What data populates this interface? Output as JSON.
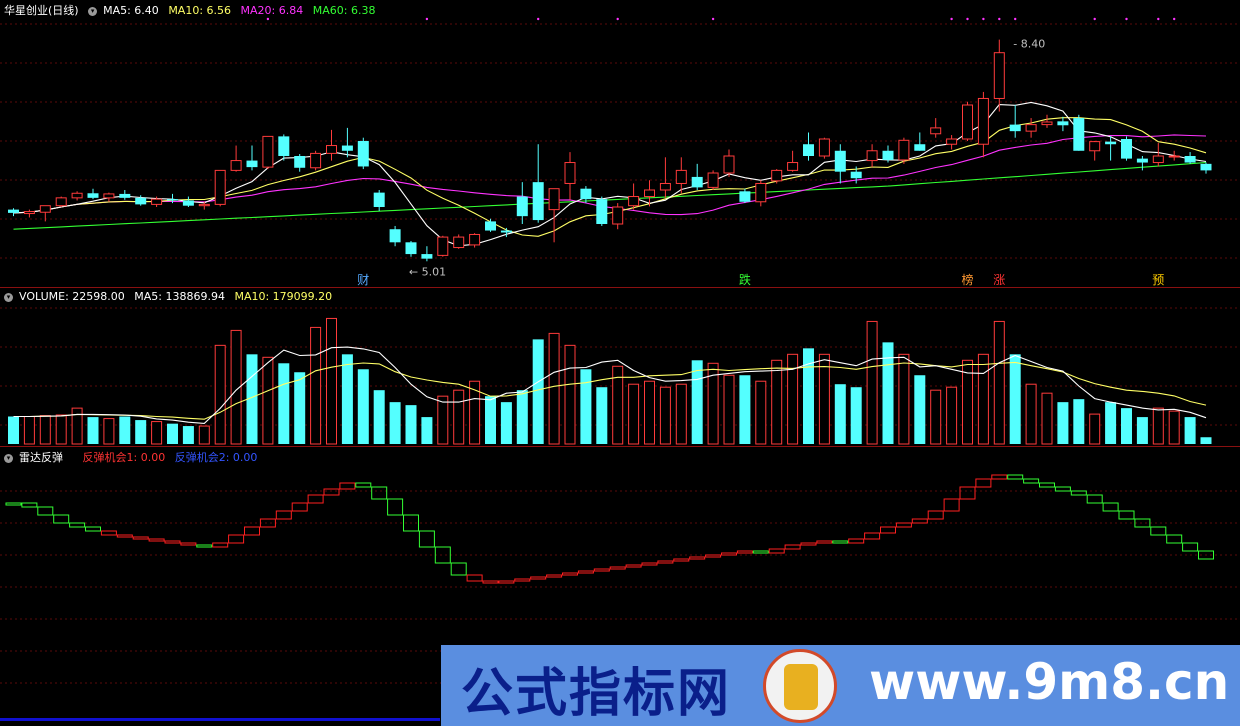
{
  "colors": {
    "up": "#ff3b3b",
    "down": "#54ffff",
    "ma5": "#ffffff",
    "ma10": "#ffff66",
    "ma20": "#ff33ff",
    "ma60": "#33ff33",
    "radar_up": "#ff2020",
    "radar_down": "#33ff33",
    "blue": "#3333ff"
  },
  "price_panel": {
    "stock_name": "华星创业(日线)",
    "ma5_label": "MA5: 6.40",
    "ma10_label": "MA10: 6.56",
    "ma20_label": "MA20: 6.84",
    "ma60_label": "MA60: 6.38",
    "high_marker": "8.40",
    "low_marker": "5.01",
    "event_labels": [
      {
        "text": "财",
        "index": 22,
        "color": "#55aaff"
      },
      {
        "text": "跌",
        "index": 46,
        "color": "#33ff33"
      },
      {
        "text": "榜",
        "index": 60,
        "color": "#ff9933"
      },
      {
        "text": "涨",
        "index": 62,
        "color": "#ff3333"
      },
      {
        "text": "预",
        "index": 72,
        "color": "#ffcc00"
      }
    ]
  },
  "volume_panel": {
    "volume_label": "VOLUME: 22598.00",
    "ma5_label": "MA5: 138869.94",
    "ma10_label": "MA10: 179099.20"
  },
  "radar_panel": {
    "name": "雷达反弹",
    "signal1_label": "反弹机会1: 0.00",
    "signal2_label": "反弹机会2: 0.00"
  },
  "watermark": {
    "text1": "公式指标网",
    "text2": "www.9m8.cn"
  },
  "chart_data": [
    {
      "type": "candlestick",
      "name": "华星创业(日线)",
      "ylim": [
        4.8,
        8.7
      ],
      "ohlc": [
        [
          5.8,
          5.82,
          5.7,
          5.75
        ],
        [
          5.74,
          5.8,
          5.68,
          5.77
        ],
        [
          5.76,
          5.85,
          5.62,
          5.86
        ],
        [
          5.86,
          6.0,
          5.84,
          5.98
        ],
        [
          5.98,
          6.08,
          5.94,
          6.05
        ],
        [
          6.05,
          6.12,
          5.96,
          5.98
        ],
        [
          5.98,
          6.06,
          5.92,
          6.04
        ],
        [
          6.04,
          6.1,
          5.95,
          5.98
        ],
        [
          5.98,
          6.02,
          5.86,
          5.88
        ],
        [
          5.88,
          6.0,
          5.84,
          5.96
        ],
        [
          5.96,
          6.04,
          5.9,
          5.94
        ],
        [
          5.94,
          6.0,
          5.84,
          5.86
        ],
        [
          5.86,
          5.92,
          5.8,
          5.88
        ],
        [
          5.88,
          6.4,
          5.85,
          6.4
        ],
        [
          6.4,
          6.78,
          6.38,
          6.55
        ],
        [
          6.55,
          6.78,
          6.4,
          6.45
        ],
        [
          6.45,
          6.92,
          6.42,
          6.92
        ],
        [
          6.92,
          6.95,
          6.55,
          6.62
        ],
        [
          6.62,
          6.65,
          6.38,
          6.44
        ],
        [
          6.44,
          6.7,
          6.4,
          6.66
        ],
        [
          6.66,
          7.02,
          6.55,
          6.78
        ],
        [
          6.78,
          7.05,
          6.6,
          6.7
        ],
        [
          6.85,
          6.9,
          6.42,
          6.46
        ],
        [
          6.06,
          6.1,
          5.78,
          5.84
        ],
        [
          5.5,
          5.55,
          5.24,
          5.3
        ],
        [
          5.3,
          5.32,
          5.08,
          5.12
        ],
        [
          5.12,
          5.24,
          5.01,
          5.05
        ],
        [
          5.1,
          5.4,
          5.08,
          5.38
        ],
        [
          5.22,
          5.42,
          5.2,
          5.38
        ],
        [
          5.26,
          5.44,
          5.22,
          5.42
        ],
        [
          5.62,
          5.66,
          5.46,
          5.48
        ],
        [
          5.48,
          5.52,
          5.38,
          5.45
        ],
        [
          6.0,
          6.22,
          5.58,
          5.7
        ],
        [
          6.22,
          6.8,
          5.6,
          5.64
        ],
        [
          5.8,
          6.1,
          5.3,
          6.12
        ],
        [
          6.2,
          6.68,
          5.95,
          6.52
        ],
        [
          6.12,
          6.16,
          5.9,
          5.96
        ],
        [
          5.96,
          6.0,
          5.55,
          5.58
        ],
        [
          5.58,
          5.9,
          5.5,
          5.84
        ],
        [
          5.86,
          6.2,
          5.8,
          6.0
        ],
        [
          6.0,
          6.25,
          5.85,
          6.1
        ],
        [
          6.1,
          6.6,
          5.98,
          6.2
        ],
        [
          6.2,
          6.6,
          6.05,
          6.4
        ],
        [
          6.3,
          6.5,
          6.1,
          6.14
        ],
        [
          6.14,
          6.4,
          6.1,
          6.36
        ],
        [
          6.36,
          6.72,
          6.3,
          6.62
        ],
        [
          6.08,
          6.12,
          5.9,
          5.92
        ],
        [
          5.92,
          6.25,
          5.85,
          6.2
        ],
        [
          6.24,
          6.42,
          6.2,
          6.4
        ],
        [
          6.4,
          6.7,
          6.38,
          6.52
        ],
        [
          6.8,
          6.98,
          6.55,
          6.62
        ],
        [
          6.62,
          6.9,
          6.58,
          6.88
        ],
        [
          6.7,
          6.8,
          6.2,
          6.38
        ],
        [
          6.38,
          6.46,
          6.2,
          6.28
        ],
        [
          6.55,
          6.8,
          6.45,
          6.7
        ],
        [
          6.7,
          6.78,
          6.52,
          6.56
        ],
        [
          6.56,
          6.9,
          6.5,
          6.86
        ],
        [
          6.8,
          6.98,
          6.7,
          6.7
        ],
        [
          6.96,
          7.2,
          6.9,
          7.05
        ],
        [
          6.8,
          6.94,
          6.72,
          6.88
        ],
        [
          6.88,
          7.45,
          6.85,
          7.4
        ],
        [
          6.8,
          7.6,
          6.6,
          7.5
        ],
        [
          7.5,
          8.4,
          7.3,
          8.2
        ],
        [
          7.1,
          7.4,
          6.9,
          7.0
        ],
        [
          7.0,
          7.2,
          6.9,
          7.1
        ],
        [
          7.1,
          7.25,
          7.05,
          7.14
        ],
        [
          7.15,
          7.22,
          7.0,
          7.09
        ],
        [
          7.2,
          7.25,
          6.7,
          6.7
        ],
        [
          6.7,
          6.85,
          6.55,
          6.84
        ],
        [
          6.84,
          6.92,
          6.55,
          6.8
        ],
        [
          6.88,
          6.92,
          6.55,
          6.58
        ],
        [
          6.58,
          6.62,
          6.4,
          6.52
        ],
        [
          6.52,
          6.82,
          6.46,
          6.62
        ],
        [
          6.62,
          6.7,
          6.55,
          6.62
        ],
        [
          6.62,
          6.68,
          6.5,
          6.52
        ],
        [
          6.5,
          6.52,
          6.35,
          6.4
        ]
      ]
    },
    {
      "type": "bar",
      "name": "VOLUME",
      "ylim": [
        0,
        475000
      ],
      "values": [
        92000,
        92000,
        95000,
        97000,
        120000,
        90000,
        85000,
        92000,
        80000,
        75000,
        68000,
        60000,
        60000,
        330000,
        380000,
        300000,
        290000,
        270000,
        240000,
        390000,
        420000,
        300000,
        250000,
        180000,
        140000,
        130000,
        90000,
        160000,
        180000,
        210000,
        160000,
        140000,
        180000,
        350000,
        370000,
        330000,
        250000,
        190000,
        260000,
        200000,
        210000,
        190000,
        200000,
        280000,
        270000,
        230000,
        230000,
        210000,
        280000,
        300000,
        320000,
        300000,
        200000,
        190000,
        410000,
        340000,
        300000,
        230000,
        180000,
        190000,
        280000,
        300000,
        410000,
        300000,
        200000,
        170000,
        140000,
        150000,
        100000,
        140000,
        120000,
        90000,
        120000,
        110000,
        90000,
        22598
      ],
      "ma5": [
        92000,
        92000,
        93000,
        94000,
        99000,
        99000,
        98000,
        97000,
        93000,
        84000,
        80000,
        73000,
        69000,
        119000,
        180000,
        226000,
        272000,
        314000,
        296000,
        298000,
        322000,
        324000,
        318000,
        306000,
        256000,
        200000,
        158000,
        140000,
        140000,
        152000,
        148000,
        170000,
        174000,
        208000,
        240000,
        254000,
        256000,
        274000,
        280000,
        246000,
        222000,
        210000,
        212000,
        216000,
        230000,
        236000,
        242000,
        244000,
        246000,
        250000,
        268000,
        282000,
        272000,
        262000,
        284000,
        288000,
        290000,
        258000,
        262000,
        250000,
        238000,
        236000,
        272000,
        296000,
        276000,
        256000,
        244000,
        194000,
        152000,
        140000,
        130000,
        120000,
        114000,
        116000,
        106000,
        88000
      ],
      "ma10": [
        92000,
        92000,
        93000,
        94000,
        99000,
        98000,
        97000,
        96000,
        95000,
        92000,
        90000,
        86000,
        83000,
        106000,
        135000,
        156000,
        178000,
        200000,
        215000,
        245000,
        257000,
        266000,
        271000,
        268000,
        242000,
        224000,
        214000,
        206000,
        200000,
        181000,
        160000,
        161000,
        168000,
        181000,
        193000,
        200000,
        205000,
        215000,
        223000,
        223000,
        228000,
        230000,
        232000,
        246000,
        250000,
        246000,
        249000,
        252000,
        254000,
        253000,
        258000,
        259000,
        256000,
        250000,
        259000,
        265000,
        271000,
        268000,
        262000,
        258000,
        266000,
        266000,
        270000,
        273000,
        262000,
        252000,
        241000,
        219000,
        202000,
        190000,
        180000,
        176000,
        170000,
        161000,
        142000,
        130000
      ]
    },
    {
      "type": "line",
      "name": "雷达反弹",
      "ylim": [
        -5,
        55
      ],
      "values": [
        46,
        45,
        43,
        41,
        40,
        39,
        38,
        37.5,
        37,
        36.5,
        36,
        35.5,
        35,
        36,
        38,
        40,
        42,
        44,
        46,
        48,
        49.5,
        51,
        50,
        47,
        43,
        39,
        35,
        31,
        28,
        26.5,
        26,
        26.5,
        27,
        27.5,
        28,
        28.5,
        29,
        29.5,
        30,
        30.5,
        31,
        31.5,
        32,
        32.5,
        33,
        33.5,
        34,
        33.5,
        34.5,
        35.5,
        36,
        36.5,
        36,
        37,
        38.5,
        40,
        41,
        42,
        44,
        47,
        50,
        52,
        53,
        52,
        51,
        50,
        49,
        48,
        46,
        44,
        42,
        40,
        38,
        36,
        34,
        32
      ],
      "up_flags": [
        0,
        0,
        0,
        0,
        0,
        0,
        1,
        1,
        1,
        1,
        1,
        1,
        0,
        1,
        1,
        1,
        1,
        1,
        1,
        1,
        1,
        1,
        0,
        0,
        0,
        0,
        0,
        0,
        0,
        1,
        1,
        1,
        1,
        1,
        1,
        1,
        1,
        1,
        1,
        1,
        1,
        1,
        1,
        1,
        1,
        1,
        1,
        0,
        1,
        1,
        1,
        1,
        0,
        1,
        1,
        1,
        1,
        1,
        1,
        1,
        1,
        1,
        1,
        0,
        0,
        0,
        0,
        0,
        0,
        0,
        0,
        0,
        0,
        0,
        0,
        0
      ]
    }
  ]
}
